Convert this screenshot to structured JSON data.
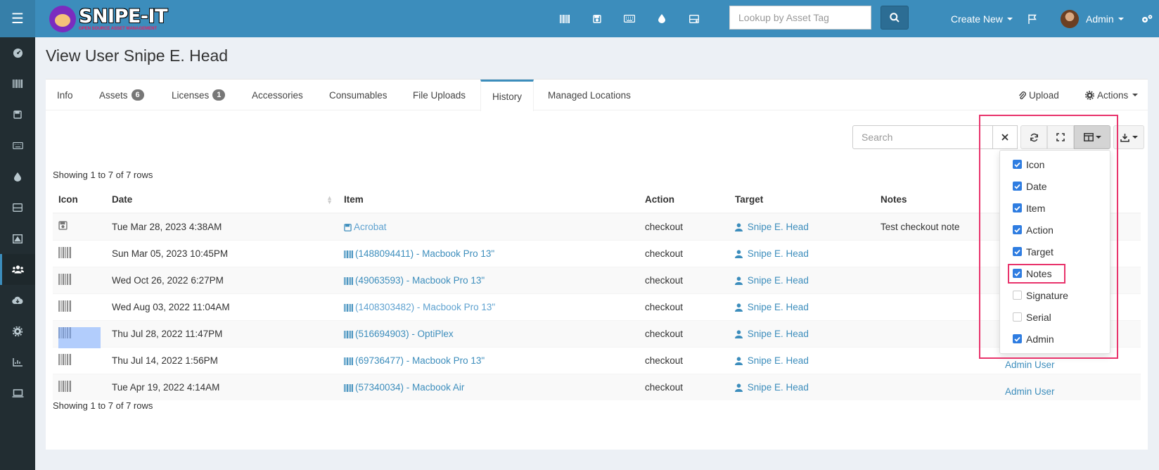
{
  "header": {
    "logo_title": "SNIPE-IT",
    "logo_subtitle": "OPEN SOURCE ASSET MANAGEMENT",
    "lookup_placeholder": "Lookup by Asset Tag",
    "create_new": "Create New",
    "user_name": "Admin",
    "top_icons": [
      "barcode-icon",
      "save-icon",
      "keyboard-icon",
      "droplet-icon",
      "hdd-icon"
    ]
  },
  "sidebar": {
    "items": [
      "dashboard-icon",
      "barcode-icon",
      "save-icon",
      "keyboard-icon",
      "droplet-icon",
      "hdd-icon",
      "kit-icon",
      "users-icon",
      "cloud-download-icon",
      "cog-icon",
      "reports-icon",
      "laptop-icon"
    ],
    "active": "users-icon"
  },
  "page": {
    "title": "View User Snipe E. Head"
  },
  "tabs": [
    {
      "label": "Info"
    },
    {
      "label": "Assets",
      "badge": "6"
    },
    {
      "label": "Licenses",
      "badge": "1"
    },
    {
      "label": "Accessories"
    },
    {
      "label": "Consumables"
    },
    {
      "label": "File Uploads"
    },
    {
      "label": "History",
      "active": true
    },
    {
      "label": "Managed Locations"
    }
  ],
  "tab_actions": {
    "upload": "Upload",
    "actions": "Actions"
  },
  "toolbar": {
    "search_placeholder": "Search"
  },
  "showing_text": "Showing 1 to 7 of 7 rows",
  "table": {
    "columns": [
      "Icon",
      "Date",
      "Item",
      "Action",
      "Target",
      "Notes"
    ],
    "rows": [
      {
        "icon": "save-icon",
        "date": "Tue Mar 28, 2023 4:38AM",
        "item": "Acrobat",
        "item_icon": "save-icon",
        "item_light": true,
        "action": "checkout",
        "target": "Snipe E. Head",
        "notes": "Test checkout note",
        "admin": ""
      },
      {
        "icon": "barcode-icon",
        "date": "Sun Mar 05, 2023 10:45PM",
        "item": "(1488094411) - Macbook Pro 13\"",
        "item_icon": "barcode-icon",
        "item_light": false,
        "action": "checkout",
        "target": "Snipe E. Head",
        "notes": "",
        "admin": ""
      },
      {
        "icon": "barcode-icon",
        "date": "Wed Oct 26, 2022 6:27PM",
        "item": "(49063593) - Macbook Pro 13\"",
        "item_icon": "barcode-icon",
        "item_light": false,
        "action": "checkout",
        "target": "Snipe E. Head",
        "notes": "",
        "admin": ""
      },
      {
        "icon": "barcode-icon",
        "date": "Wed Aug 03, 2022 11:04AM",
        "item": "(1408303482) - Macbook Pro 13\"",
        "item_icon": "barcode-icon",
        "item_light": true,
        "action": "checkout",
        "target": "Snipe E. Head",
        "notes": "",
        "admin": ""
      },
      {
        "icon": "barcode-icon",
        "date": "Thu Jul 28, 2022 11:47PM",
        "item": "(516694903) - OptiPlex",
        "item_icon": "barcode-icon",
        "item_light": false,
        "action": "checkout",
        "target": "Snipe E. Head",
        "notes": "",
        "admin": "",
        "highlight": true
      },
      {
        "icon": "barcode-icon",
        "date": "Thu Jul 14, 2022 1:56PM",
        "item": "(69736477) - Macbook Pro 13\"",
        "item_icon": "barcode-icon",
        "item_light": false,
        "action": "checkout",
        "target": "Snipe E. Head",
        "notes": "",
        "admin": "Admin User"
      },
      {
        "icon": "barcode-icon",
        "date": "Tue Apr 19, 2022 4:14AM",
        "item": "(57340034) - Macbook Air",
        "item_icon": "barcode-icon",
        "item_light": false,
        "action": "checkout",
        "target": "Snipe E. Head",
        "notes": "",
        "admin": "Admin User"
      }
    ]
  },
  "columns_dropdown": [
    {
      "label": "Icon",
      "checked": true
    },
    {
      "label": "Date",
      "checked": true
    },
    {
      "label": "Item",
      "checked": true
    },
    {
      "label": "Action",
      "checked": true
    },
    {
      "label": "Target",
      "checked": true
    },
    {
      "label": "Notes",
      "checked": true
    },
    {
      "label": "Signature",
      "checked": false
    },
    {
      "label": "Serial",
      "checked": false
    },
    {
      "label": "Admin",
      "checked": true
    }
  ],
  "colors": {
    "header": "#3c8dbc",
    "sidebar": "#222d32",
    "link": "#3c8dbc",
    "highlight_border": "#e8336b",
    "checkbox": "#2f7de1"
  }
}
